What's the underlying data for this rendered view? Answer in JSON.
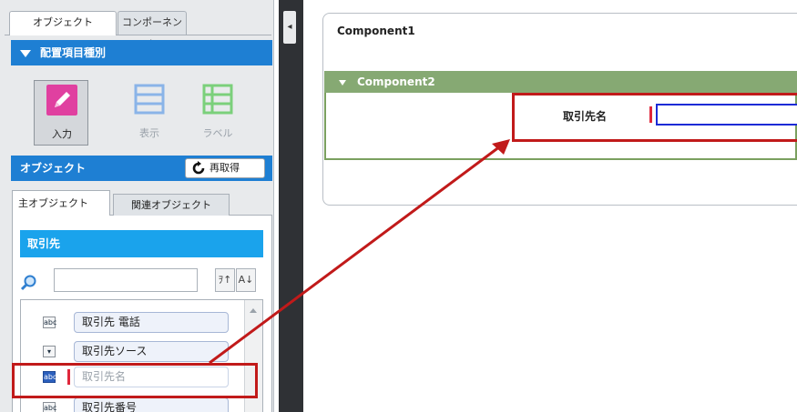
{
  "left_panel": {
    "tabs": {
      "objects": "オブジェクト",
      "components": "コンポーネント"
    },
    "placement": {
      "header": "配置項目種別",
      "items": [
        {
          "label": "入力",
          "icon": "pencil-icon",
          "color": "#e040a0"
        },
        {
          "label": "表示",
          "icon": "list-view-icon",
          "color": "#8ab4e8"
        },
        {
          "label": "ラベル",
          "icon": "label-grid-icon",
          "color": "#7bd07b"
        }
      ]
    },
    "object_section": {
      "header": "オブジェクト",
      "refresh_label": "再取得",
      "subtabs": {
        "main": "主オブジェクト",
        "related": "関連オブジェクト"
      },
      "current_object": "取引先",
      "search": {
        "value": "",
        "placeholder": ""
      },
      "sort_buttons": {
        "asc": "ｦ↑",
        "alpha": "A↓"
      },
      "fields": [
        {
          "label": "取引先 電話",
          "type_icon": "abc"
        },
        {
          "label": "取引先ソース",
          "type_icon": "▾"
        },
        {
          "label": "取引先名",
          "type_icon": "abc"
        },
        {
          "label": "取引先番号",
          "type_icon": "abc"
        }
      ]
    }
  },
  "canvas": {
    "component1": {
      "title": "Component1"
    },
    "component2": {
      "title": "Component2"
    },
    "field": {
      "label": "取引先名",
      "value": ""
    }
  },
  "colors": {
    "accent_blue": "#1e7fd3",
    "section_blue": "#1aa3ec",
    "component_green": "#86a973",
    "highlight_red": "#c11a1a",
    "input_border": "#1b2bd6"
  }
}
